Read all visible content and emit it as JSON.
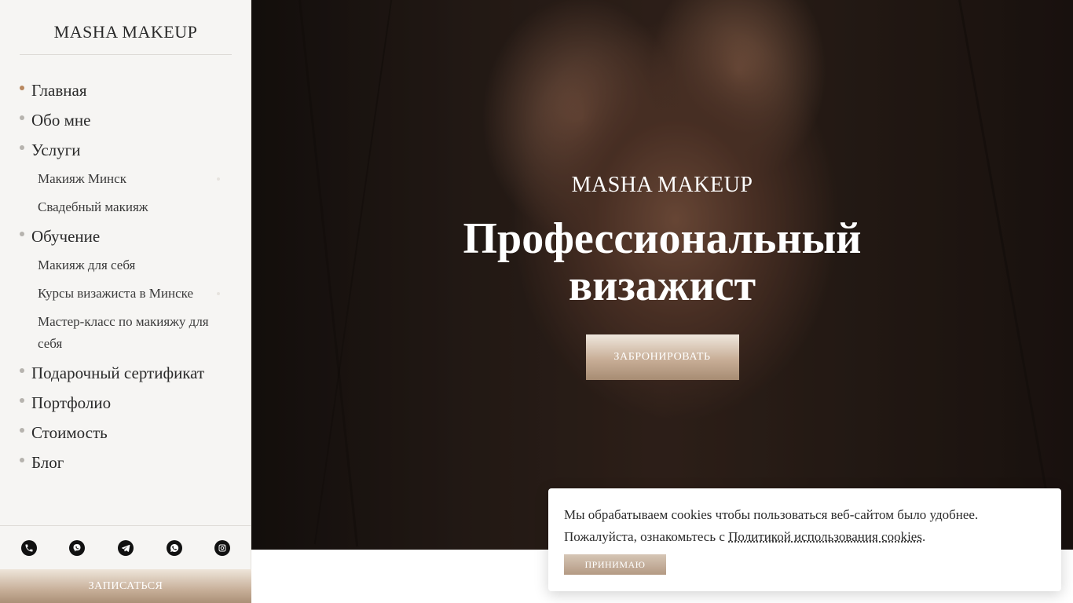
{
  "sidebar": {
    "brand": "MASHA MAKEUP",
    "nav": {
      "home": "Главная",
      "about": "Обо мне",
      "services": "Услуги",
      "services_sub": [
        "Макияж Минск",
        "Свадебный макияж"
      ],
      "training": "Обучение",
      "training_sub": [
        "Макияж для себя",
        "Курсы визажиста в Минске",
        "Мастер-класс по макияжу для себя"
      ],
      "gift": "Подарочный сертификат",
      "portfolio": "Портфолио",
      "prices": "Стоимость",
      "blog": "Блог"
    },
    "social": [
      "phone-icon",
      "viber-icon",
      "telegram-icon",
      "whatsapp-icon",
      "instagram-icon"
    ],
    "book_label": "ЗАПИСАТЬСЯ"
  },
  "hero": {
    "brand": "MASHA MAKEUP",
    "title_line1": "Профессиональный",
    "title_line2": "визажист",
    "button": "ЗАБРОНИРОВАТЬ"
  },
  "cookie": {
    "text1": "Мы обрабатываем cookies чтобы пользоваться веб-сайтом было удобнее.",
    "text2_prefix": "Пожалуйста, ознакомьтесь с ",
    "link": "Политикой использования cookies",
    "text2_suffix": ".",
    "button": "ПРИНИМАЮ"
  },
  "colors": {
    "accent": "#b8875e",
    "button_gradient_top": "#efe7dd",
    "button_gradient_bottom": "#a78c73",
    "sidebar_bg": "#f6f5f3"
  }
}
